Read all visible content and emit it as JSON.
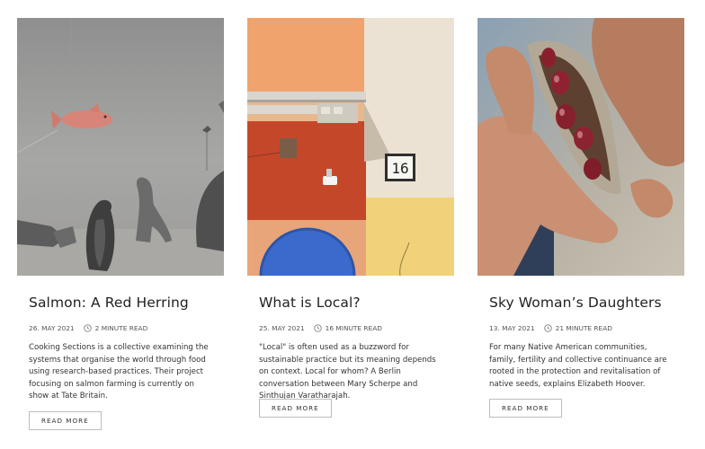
{
  "articles": [
    {
      "title": "Salmon: A Red Herring",
      "date": "26. MAY 2021",
      "read_time": "2 MINUTE READ",
      "description": "Cooking Sections is a collective examining the systems that organise the world through food using research-based practices. Their project focusing on salmon farming is currently on show at Tate Britain.",
      "button": "READ MORE"
    },
    {
      "title": "What is Local?",
      "date": "25. MAY 2021",
      "read_time": "16 MINUTE READ",
      "description": "\"Local\" is often used as a buzzword for sustainable practice but its meaning depends on context. Local for whom? A Berlin conversation between Mary Scherpe and Sinthujan Varatharajah.",
      "button": "READ MORE",
      "house_number": "16"
    },
    {
      "title": "Sky Woman’s Daughters",
      "date": "13. MAY 2021",
      "read_time": "21 MINUTE READ",
      "description": "For many Native American communities, family, fertility and collective continuance are rooted in the protection and revitalisation of native seeds, explains Elizabeth Hoover.",
      "button": "READ MORE"
    }
  ],
  "icons": {
    "read_time": "clock-icon"
  },
  "colors": {
    "text": "#222222",
    "button_border": "#bdbdbd",
    "background": "#ffffff"
  }
}
